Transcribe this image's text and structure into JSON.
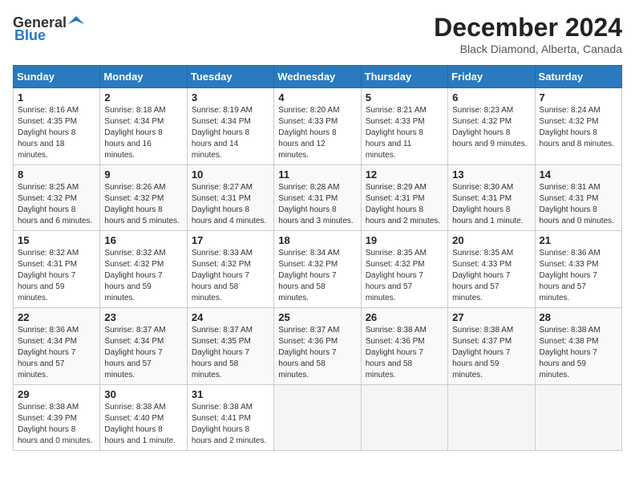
{
  "logo": {
    "general": "General",
    "blue": "Blue"
  },
  "header": {
    "month": "December 2024",
    "location": "Black Diamond, Alberta, Canada"
  },
  "weekdays": [
    "Sunday",
    "Monday",
    "Tuesday",
    "Wednesday",
    "Thursday",
    "Friday",
    "Saturday"
  ],
  "weeks": [
    [
      {
        "day": "1",
        "sunrise": "8:16 AM",
        "sunset": "4:35 PM",
        "daylight": "8 hours and 18 minutes."
      },
      {
        "day": "2",
        "sunrise": "8:18 AM",
        "sunset": "4:34 PM",
        "daylight": "8 hours and 16 minutes."
      },
      {
        "day": "3",
        "sunrise": "8:19 AM",
        "sunset": "4:34 PM",
        "daylight": "8 hours and 14 minutes."
      },
      {
        "day": "4",
        "sunrise": "8:20 AM",
        "sunset": "4:33 PM",
        "daylight": "8 hours and 12 minutes."
      },
      {
        "day": "5",
        "sunrise": "8:21 AM",
        "sunset": "4:33 PM",
        "daylight": "8 hours and 11 minutes."
      },
      {
        "day": "6",
        "sunrise": "8:23 AM",
        "sunset": "4:32 PM",
        "daylight": "8 hours and 9 minutes."
      },
      {
        "day": "7",
        "sunrise": "8:24 AM",
        "sunset": "4:32 PM",
        "daylight": "8 hours and 8 minutes."
      }
    ],
    [
      {
        "day": "8",
        "sunrise": "8:25 AM",
        "sunset": "4:32 PM",
        "daylight": "8 hours and 6 minutes."
      },
      {
        "day": "9",
        "sunrise": "8:26 AM",
        "sunset": "4:32 PM",
        "daylight": "8 hours and 5 minutes."
      },
      {
        "day": "10",
        "sunrise": "8:27 AM",
        "sunset": "4:31 PM",
        "daylight": "8 hours and 4 minutes."
      },
      {
        "day": "11",
        "sunrise": "8:28 AM",
        "sunset": "4:31 PM",
        "daylight": "8 hours and 3 minutes."
      },
      {
        "day": "12",
        "sunrise": "8:29 AM",
        "sunset": "4:31 PM",
        "daylight": "8 hours and 2 minutes."
      },
      {
        "day": "13",
        "sunrise": "8:30 AM",
        "sunset": "4:31 PM",
        "daylight": "8 hours and 1 minute."
      },
      {
        "day": "14",
        "sunrise": "8:31 AM",
        "sunset": "4:31 PM",
        "daylight": "8 hours and 0 minutes."
      }
    ],
    [
      {
        "day": "15",
        "sunrise": "8:32 AM",
        "sunset": "4:31 PM",
        "daylight": "7 hours and 59 minutes."
      },
      {
        "day": "16",
        "sunrise": "8:32 AM",
        "sunset": "4:32 PM",
        "daylight": "7 hours and 59 minutes."
      },
      {
        "day": "17",
        "sunrise": "8:33 AM",
        "sunset": "4:32 PM",
        "daylight": "7 hours and 58 minutes."
      },
      {
        "day": "18",
        "sunrise": "8:34 AM",
        "sunset": "4:32 PM",
        "daylight": "7 hours and 58 minutes."
      },
      {
        "day": "19",
        "sunrise": "8:35 AM",
        "sunset": "4:32 PM",
        "daylight": "7 hours and 57 minutes."
      },
      {
        "day": "20",
        "sunrise": "8:35 AM",
        "sunset": "4:33 PM",
        "daylight": "7 hours and 57 minutes."
      },
      {
        "day": "21",
        "sunrise": "8:36 AM",
        "sunset": "4:33 PM",
        "daylight": "7 hours and 57 minutes."
      }
    ],
    [
      {
        "day": "22",
        "sunrise": "8:36 AM",
        "sunset": "4:34 PM",
        "daylight": "7 hours and 57 minutes."
      },
      {
        "day": "23",
        "sunrise": "8:37 AM",
        "sunset": "4:34 PM",
        "daylight": "7 hours and 57 minutes."
      },
      {
        "day": "24",
        "sunrise": "8:37 AM",
        "sunset": "4:35 PM",
        "daylight": "7 hours and 58 minutes."
      },
      {
        "day": "25",
        "sunrise": "8:37 AM",
        "sunset": "4:36 PM",
        "daylight": "7 hours and 58 minutes."
      },
      {
        "day": "26",
        "sunrise": "8:38 AM",
        "sunset": "4:36 PM",
        "daylight": "7 hours and 58 minutes."
      },
      {
        "day": "27",
        "sunrise": "8:38 AM",
        "sunset": "4:37 PM",
        "daylight": "7 hours and 59 minutes."
      },
      {
        "day": "28",
        "sunrise": "8:38 AM",
        "sunset": "4:38 PM",
        "daylight": "7 hours and 59 minutes."
      }
    ],
    [
      {
        "day": "29",
        "sunrise": "8:38 AM",
        "sunset": "4:39 PM",
        "daylight": "8 hours and 0 minutes."
      },
      {
        "day": "30",
        "sunrise": "8:38 AM",
        "sunset": "4:40 PM",
        "daylight": "8 hours and 1 minute."
      },
      {
        "day": "31",
        "sunrise": "8:38 AM",
        "sunset": "4:41 PM",
        "daylight": "8 hours and 2 minutes."
      },
      null,
      null,
      null,
      null
    ]
  ]
}
